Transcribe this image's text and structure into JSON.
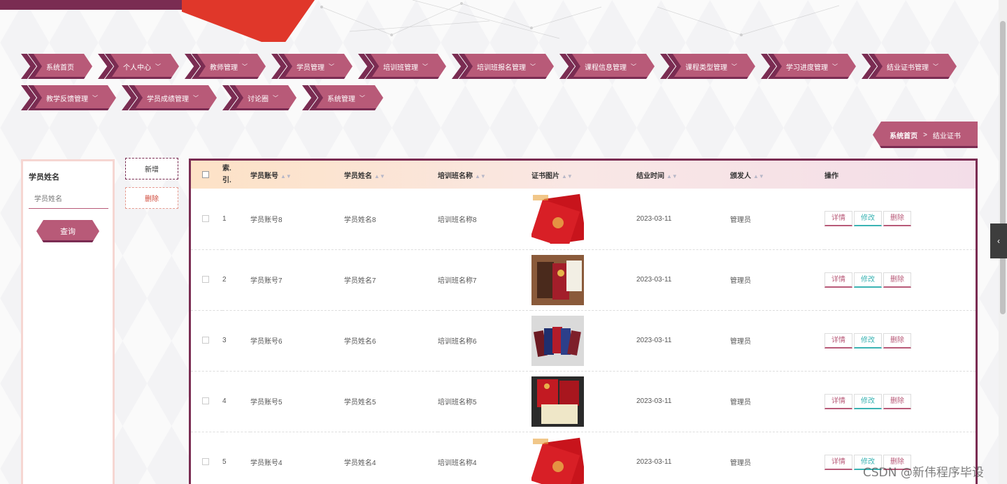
{
  "nav": {
    "row1": [
      {
        "label": "系统首页",
        "caret": false
      },
      {
        "label": "个人中心",
        "caret": true
      },
      {
        "label": "教师管理",
        "caret": true
      },
      {
        "label": "学员管理",
        "caret": true
      },
      {
        "label": "培训班管理",
        "caret": true
      },
      {
        "label": "培训班报名管理",
        "caret": true
      },
      {
        "label": "课程信息管理",
        "caret": true
      },
      {
        "label": "课程类型管理",
        "caret": true
      },
      {
        "label": "学习进度管理",
        "caret": true
      },
      {
        "label": "结业证书管理",
        "caret": true
      }
    ],
    "row2": [
      {
        "label": "教学反馈管理",
        "caret": true
      },
      {
        "label": "学员成绩管理",
        "caret": true
      },
      {
        "label": "讨论圈",
        "caret": true
      },
      {
        "label": "系统管理",
        "caret": true
      }
    ]
  },
  "breadcrumb": {
    "home": "系统首页",
    "separator": ">",
    "current": "结业证书"
  },
  "search": {
    "label": "学员姓名",
    "placeholder": "学员姓名",
    "button": "查询"
  },
  "actions": {
    "add": "新增",
    "delete": "删除"
  },
  "table": {
    "headers": [
      "索引",
      "学员账号",
      "学员姓名",
      "培训班名称",
      "证书图片",
      "结业时间",
      "颁发人",
      "操作"
    ],
    "index_header_lines": [
      "索.",
      "引."
    ],
    "row_buttons": {
      "detail": "详情",
      "edit": "修改",
      "delete": "删除"
    },
    "rows": [
      {
        "index": "1",
        "account": "学员账号8",
        "name": "学员姓名8",
        "class_name": "培训班名称8",
        "image": "red-certificate",
        "date": "2023-03-11",
        "issuer": "管理员"
      },
      {
        "index": "2",
        "account": "学员账号7",
        "name": "学员姓名7",
        "class_name": "培训班名称7",
        "image": "brown-certificate",
        "date": "2023-03-11",
        "issuer": "管理员"
      },
      {
        "index": "3",
        "account": "学员账号6",
        "name": "学员姓名6",
        "class_name": "培训班名称6",
        "image": "multicolor-certificates",
        "date": "2023-03-11",
        "issuer": "管理员"
      },
      {
        "index": "4",
        "account": "学员账号5",
        "name": "学员姓名5",
        "class_name": "培训班名称5",
        "image": "dark-certificate",
        "date": "2023-03-11",
        "issuer": "管理员"
      },
      {
        "index": "5",
        "account": "学员账号4",
        "name": "学员姓名4",
        "class_name": "培训班名称4",
        "image": "red-certificate",
        "date": "2023-03-11",
        "issuer": "管理员"
      }
    ]
  },
  "side_tab": {
    "icon": "chevron-left-icon"
  },
  "watermark": "CSDN @新伟程序毕设"
}
